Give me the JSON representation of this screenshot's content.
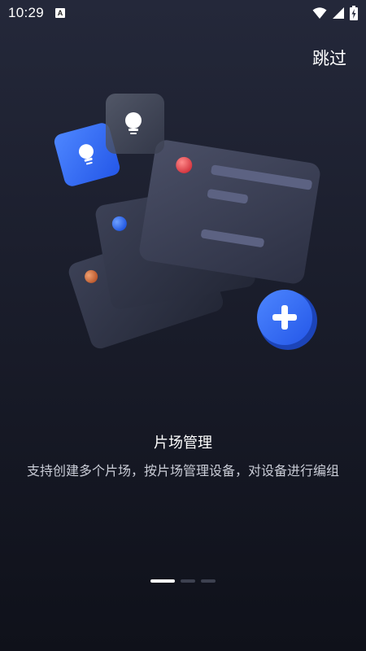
{
  "status_bar": {
    "time": "10:29",
    "notification_badge": "A",
    "icons": [
      "wifi-icon",
      "signal-icon",
      "battery-charging-icon"
    ]
  },
  "header": {
    "skip_label": "跳过"
  },
  "slide": {
    "title": "片场管理",
    "description": "支持创建多个片场，按片场管理设备，对设备进行编组"
  },
  "pager": {
    "total": 3,
    "active_index": 0
  },
  "colors": {
    "accent_blue": "#2f6bff",
    "card_dark": "#3a3f54",
    "background_top": "#24283a",
    "background_bottom": "#0f111a"
  }
}
